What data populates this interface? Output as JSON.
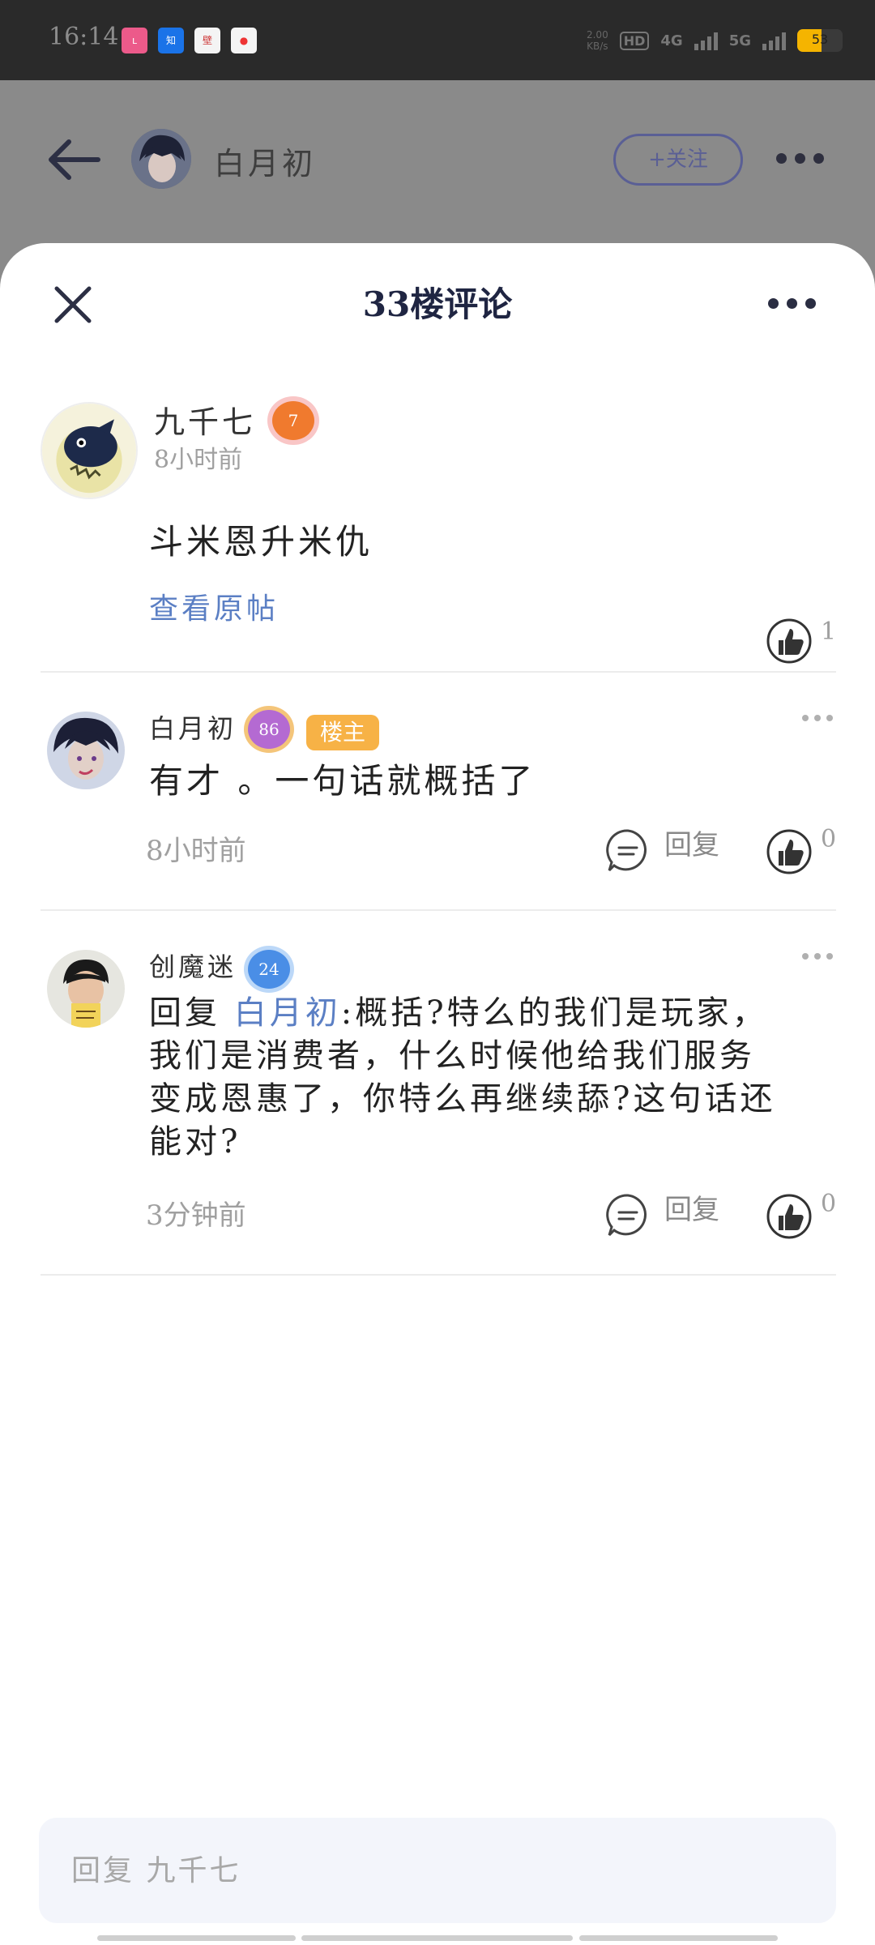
{
  "status_bar": {
    "time": "16:14",
    "apps": [
      "Lofter",
      "知乎",
      "壁纸",
      "地图"
    ],
    "speed_value": "2.00",
    "speed_unit": "KB/s",
    "hd_badge": "HD",
    "sim1": "1",
    "sim2": "2",
    "net_4g": "4G",
    "net_5g": "5G",
    "battery_level": "53",
    "battery_fraction": 0.53
  },
  "header": {
    "username": "白月初",
    "follow_label": "+关注"
  },
  "sheet": {
    "title": "33楼评论"
  },
  "main_post": {
    "author": "九千七",
    "level": "7",
    "time": "8小时前",
    "text": "斗米恩升米仇",
    "view_original": "查看原帖",
    "likes": "1"
  },
  "comments": [
    {
      "author": "白月初",
      "level": "86",
      "owner_tag": "楼主",
      "text": "有才 。一句话就概括了",
      "time": "8小时前",
      "reply_label": "回复",
      "likes": "0"
    },
    {
      "author": "创魔迷",
      "level": "24",
      "reply_prefix": "回复",
      "reply_to": "白月初",
      "text_line1": ":概括?特么的我们是玩家，",
      "text_line2": "我们是消费者，什么时候他给我们服务",
      "text_line3": "变成恩惠了，你特么再继续舔?这句话还",
      "text_line4": "能对?",
      "time": "3分钟前",
      "reply_label": "回复",
      "likes": "0"
    }
  ],
  "composer": {
    "placeholder": "回复 九千七"
  },
  "colors": {
    "accent": "#5b7fc4",
    "owner_tag": "#f7b246",
    "title": "#1f2542"
  }
}
